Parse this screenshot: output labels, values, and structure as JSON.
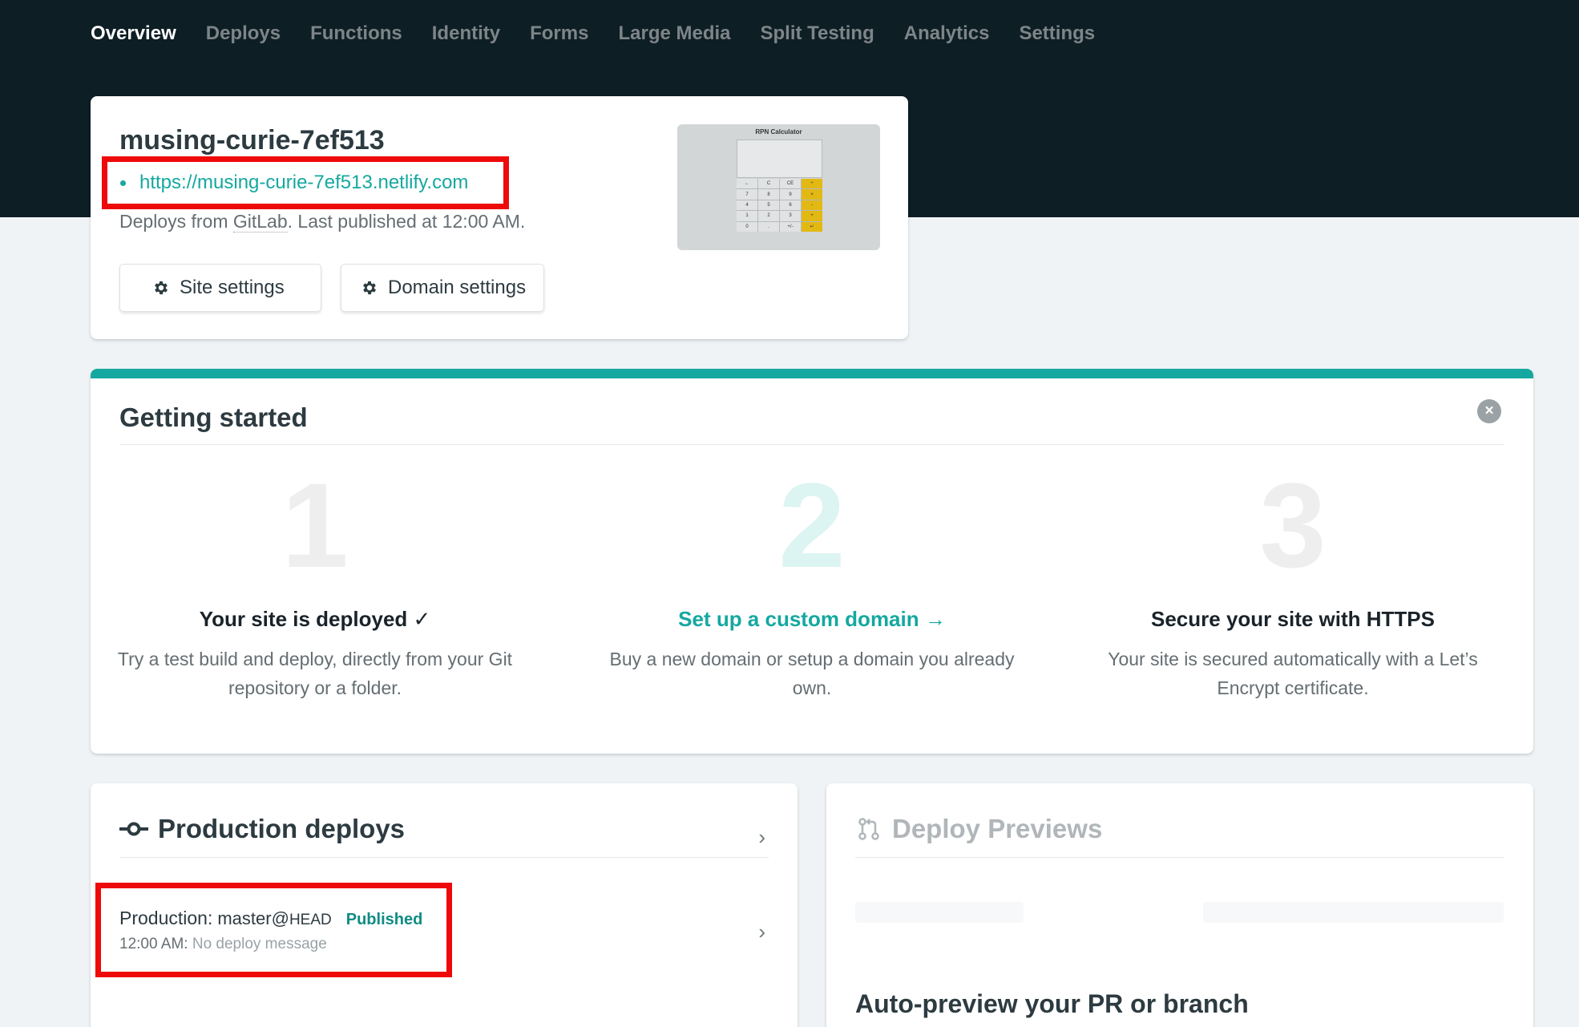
{
  "nav": {
    "items": [
      {
        "label": "Overview"
      },
      {
        "label": "Deploys"
      },
      {
        "label": "Functions"
      },
      {
        "label": "Identity"
      },
      {
        "label": "Forms"
      },
      {
        "label": "Large Media"
      },
      {
        "label": "Split Testing"
      },
      {
        "label": "Analytics"
      },
      {
        "label": "Settings"
      }
    ],
    "active": "Overview"
  },
  "site": {
    "name": "musing-curie-7ef513",
    "url": "https://musing-curie-7ef513.netlify.com",
    "meta_prefix": "Deploys from ",
    "meta_provider": "GitLab",
    "meta_suffix": ". Last published at 12:00 AM.",
    "site_settings_label": "Site settings",
    "domain_settings_label": "Domain settings",
    "thumbnail_title": "RPN Calculator"
  },
  "getting_started": {
    "title": "Getting started",
    "close_icon": "×",
    "steps": [
      {
        "number": "1",
        "title": "Your site is deployed ✓",
        "description": "Try a test build and deploy, directly from your Git repository or a folder."
      },
      {
        "number": "2",
        "title": "Set up a custom domain →",
        "description": "Buy a new domain or setup a domain you already own."
      },
      {
        "number": "3",
        "title": "Secure your site with HTTPS",
        "description": "Your site is secured automatically with a Let’s Encrypt certificate."
      }
    ]
  },
  "production_deploys": {
    "title": "Production deploys",
    "deploy": {
      "context": "Production:",
      "branch": "master@",
      "commit": "HEAD",
      "status": "Published",
      "time": "12:00 AM:",
      "message": "No deploy message"
    }
  },
  "deploy_previews": {
    "title": "Deploy Previews",
    "cta": "Auto-preview your PR or branch"
  },
  "colors": {
    "accent": "#15a8a0",
    "header_bg": "#0e1e25",
    "highlight": "#ee0a0a"
  }
}
